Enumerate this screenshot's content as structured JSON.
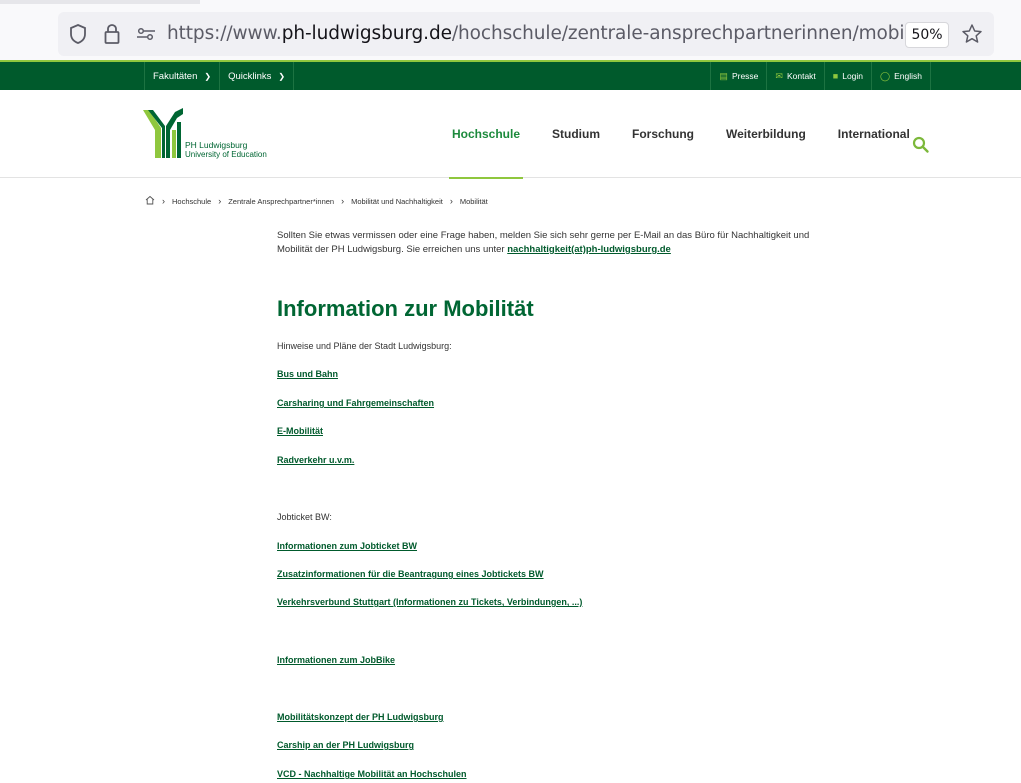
{
  "browser": {
    "url_prefix": "https://www.",
    "url_host": "ph-ludwigsburg.de",
    "url_path": "/hochschule/zentrale-ansprechpartnerinnen/mobilitaet-und-nachh",
    "zoom": "50%"
  },
  "topbar": {
    "menus": [
      {
        "label": "Fakultäten"
      },
      {
        "label": "Quicklinks"
      }
    ],
    "links": [
      {
        "label": "Presse"
      },
      {
        "label": "Kontakt"
      },
      {
        "label": "Login"
      },
      {
        "label": "English"
      }
    ]
  },
  "header": {
    "logo_line1": "PH Ludwigsburg",
    "logo_line2": "University of Education",
    "nav": [
      {
        "label": "Hochschule"
      },
      {
        "label": "Studium"
      },
      {
        "label": "Forschung"
      },
      {
        "label": "Weiterbildung"
      },
      {
        "label": "International"
      }
    ]
  },
  "breadcrumb": [
    "Hochschule",
    "Zentrale Ansprechpartner*innen",
    "Mobilität und Nachhaltigkeit",
    "Mobilität"
  ],
  "content": {
    "intro_text": "Sollten Sie etwas vermissen oder eine Frage haben, melden Sie sich sehr gerne per E-Mail an das Büro für Nachhaltigkeit und Mobilität der PH Ludwigsburg. Sie erreichen uns unter ",
    "intro_link": "nachhaltigkeit(at)ph-ludwigsburg.de",
    "heading": "Information zur Mobilität",
    "city_intro": "Hinweise und Pläne der Stadt Ludwigsburg:",
    "city_links": [
      "Bus und Bahn",
      "Carsharing und Fahrgemeinschaften",
      "E-Mobilität",
      "Radverkehr u.v.m."
    ],
    "jobticket_label": "Jobticket BW:",
    "jobticket_links": [
      "Informationen zum Jobticket BW",
      "Zusatzinformationen für die Beantragung eines Jobtickets BW",
      "Verkehrsverbund Stuttgart (Informationen zu Tickets, Verbindungen, ...)"
    ],
    "jobbike_link": "Informationen zum JobBike",
    "more_links": [
      "Mobilitätskonzept der PH Ludwigsburg",
      "Carship an der PH Ludwigsburg",
      "VCD - Nachhaltige Mobilität an Hochschulen"
    ]
  }
}
